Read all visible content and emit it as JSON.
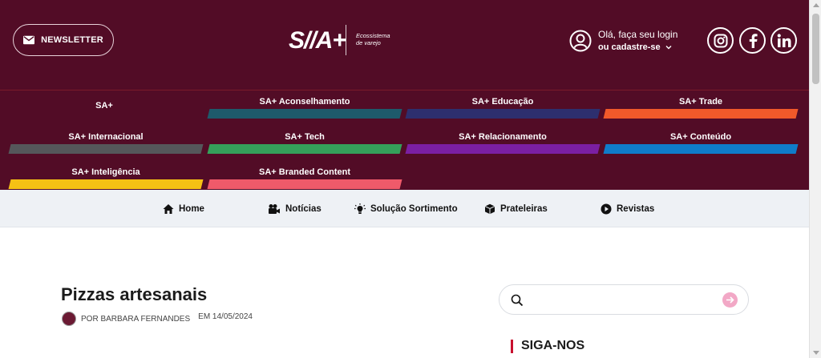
{
  "header": {
    "newsletter_label": "NEWSLETTER",
    "logo_text": "S//A+",
    "logo_tagline_line1": "Ecossistema",
    "logo_tagline_line2": "de varejo",
    "login_line1": "Olá, faça seu login",
    "login_line2": "ou cadastre-se",
    "social": [
      "instagram-icon",
      "facebook-icon",
      "linkedin-icon"
    ]
  },
  "categories": [
    {
      "label": "SA+",
      "color": "#520c26"
    },
    {
      "label": "SA+ Aconselhamento",
      "color": "#1e5a6b"
    },
    {
      "label": "SA+ Educação",
      "color": "#2d2f6e"
    },
    {
      "label": "SA+ Trade",
      "color": "#f1592a"
    },
    {
      "label": "SA+ Internacional",
      "color": "#55575a"
    },
    {
      "label": "SA+ Tech",
      "color": "#35a05a"
    },
    {
      "label": "SA+ Relacionamento",
      "color": "#7b1fa2"
    },
    {
      "label": "SA+ Conteúdo",
      "color": "#0f7cc9"
    },
    {
      "label": "SA+ Inteligência",
      "color": "#f5c114"
    },
    {
      "label": "SA+ Branded Content",
      "color": "#ef5a6a"
    }
  ],
  "nav": {
    "home": "Home",
    "noticias": "Notícias",
    "solucao": "Solução Sortimento",
    "prateleiras": "Prateleiras",
    "revistas": "Revistas"
  },
  "article": {
    "title": "Pizzas artesanais",
    "author": "POR BARBARA FERNANDES",
    "date": "EM 14/05/2024"
  },
  "sidebar": {
    "search_placeholder": "",
    "follow_title": "SIGA-NOS"
  },
  "colors": {
    "brand": "#520c26",
    "nav_bg": "#eef1f5",
    "search_go": "#f2a8c6",
    "accent_red": "#c8102e"
  }
}
